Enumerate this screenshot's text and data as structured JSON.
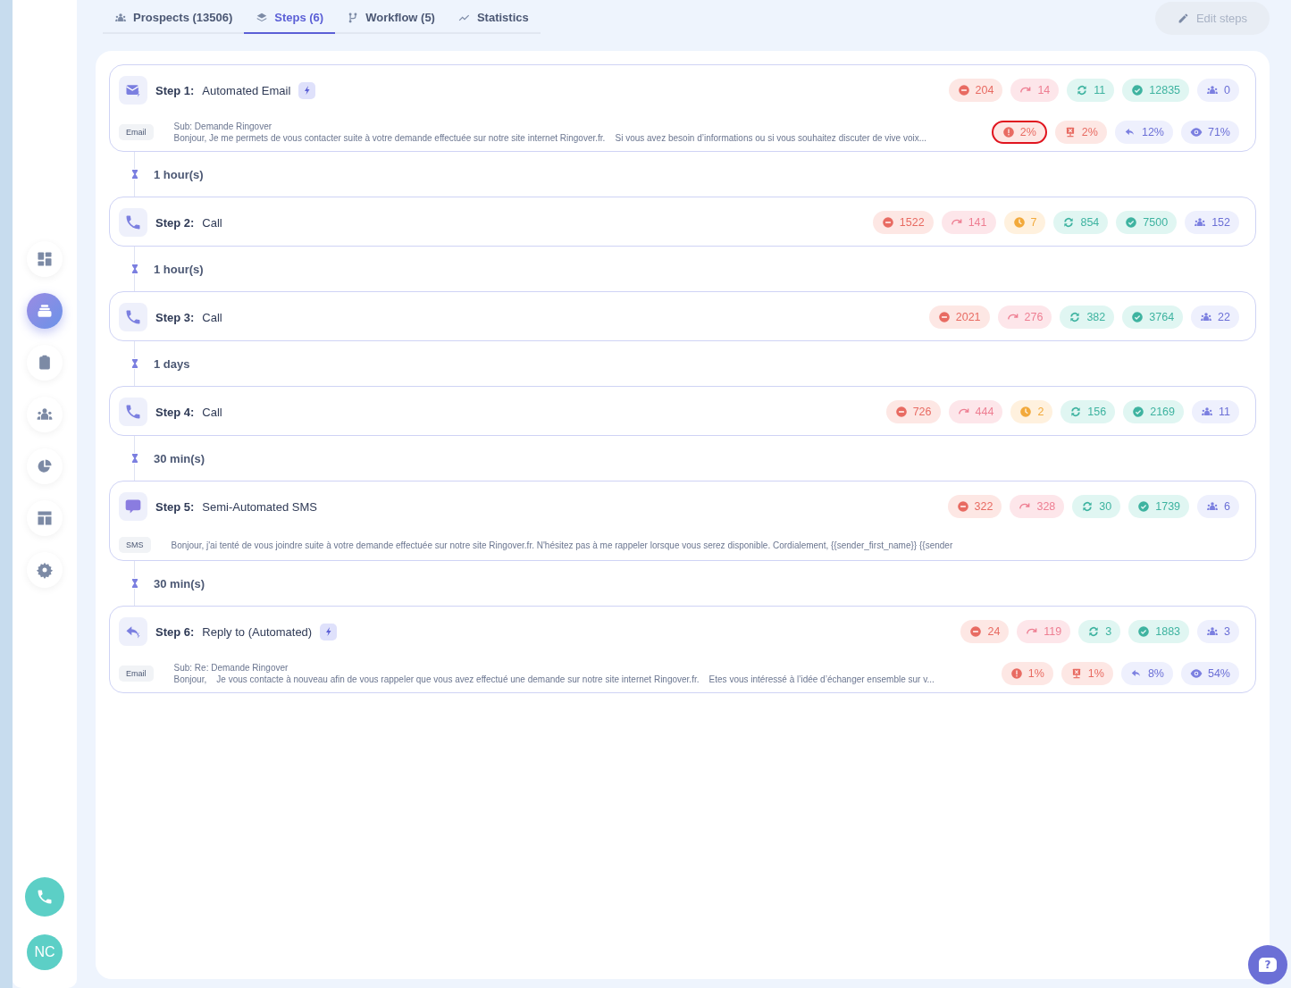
{
  "sidebar": {
    "items": [
      {
        "selected": false
      },
      {
        "selected": true
      },
      {
        "selected": false
      },
      {
        "selected": false
      },
      {
        "selected": false
      },
      {
        "selected": false
      },
      {
        "selected": false
      }
    ],
    "avatar": "NC"
  },
  "tabs": [
    {
      "label": "Prospects (13506)",
      "selected": false
    },
    {
      "label": "Steps (6)",
      "selected": true
    },
    {
      "label": "Workflow (5)",
      "selected": false
    },
    {
      "label": "Statistics",
      "selected": false
    }
  ],
  "help_button": {
    "label": "?"
  },
  "edit_button": {
    "label": "Edit steps",
    "disabled": true
  },
  "steps": [
    {
      "number": "Step 1:",
      "name": "Automated Email",
      "kind": "email",
      "automated": true,
      "stats": [
        {
          "kind": "bounced",
          "value": "204"
        },
        {
          "kind": "skipped",
          "value": "14"
        },
        {
          "kind": "recurring",
          "value": "11"
        },
        {
          "kind": "completed",
          "value": "12835"
        },
        {
          "kind": "prospects",
          "value": "0"
        }
      ],
      "message": {
        "tag": "Email",
        "subject": "Sub: Demande Ringover",
        "body": "Bonjour, Je me permets de vous contacter suite à votre demande effectuée sur notre site internet Ringover.fr.    Si vous avez besoin d’informations ou si vous souhaitez discuter de vive voix..."
      },
      "rates": [
        {
          "kind": "error",
          "value": "2%",
          "highlighted": true
        },
        {
          "kind": "unsubscribed",
          "value": "2%",
          "highlighted": false
        },
        {
          "kind": "replied",
          "value": "12%",
          "highlighted": false
        },
        {
          "kind": "opened",
          "value": "71%",
          "highlighted": false
        }
      ],
      "delay": "1 hour(s)"
    },
    {
      "number": "Step 2:",
      "name": "Call",
      "kind": "call",
      "automated": false,
      "stats": [
        {
          "kind": "bounced",
          "value": "1522"
        },
        {
          "kind": "skipped",
          "value": "141"
        },
        {
          "kind": "pending",
          "value": "7"
        },
        {
          "kind": "recurring",
          "value": "854"
        },
        {
          "kind": "completed",
          "value": "7500"
        },
        {
          "kind": "prospects",
          "value": "152"
        }
      ],
      "delay": "1 hour(s)"
    },
    {
      "number": "Step 3:",
      "name": "Call",
      "kind": "call",
      "automated": false,
      "stats": [
        {
          "kind": "bounced",
          "value": "2021"
        },
        {
          "kind": "skipped",
          "value": "276"
        },
        {
          "kind": "recurring",
          "value": "382"
        },
        {
          "kind": "completed",
          "value": "3764"
        },
        {
          "kind": "prospects",
          "value": "22"
        }
      ],
      "delay": "1 days"
    },
    {
      "number": "Step 4:",
      "name": "Call",
      "kind": "call",
      "automated": false,
      "stats": [
        {
          "kind": "bounced",
          "value": "726"
        },
        {
          "kind": "skipped",
          "value": "444"
        },
        {
          "kind": "pending",
          "value": "2"
        },
        {
          "kind": "recurring",
          "value": "156"
        },
        {
          "kind": "completed",
          "value": "2169"
        },
        {
          "kind": "prospects",
          "value": "11"
        }
      ],
      "delay": "30 min(s)"
    },
    {
      "number": "Step 5:",
      "name": "Semi-Automated SMS",
      "kind": "sms",
      "automated": false,
      "stats": [
        {
          "kind": "bounced",
          "value": "322"
        },
        {
          "kind": "skipped",
          "value": "328"
        },
        {
          "kind": "recurring",
          "value": "30"
        },
        {
          "kind": "completed",
          "value": "1739"
        },
        {
          "kind": "prospects",
          "value": "6"
        }
      ],
      "message": {
        "tag": "SMS",
        "body": "Bonjour, j'ai tenté de vous joindre suite à votre demande effectuée sur notre site Ringover.fr. N'hésitez pas à me rappeler lorsque vous serez disponible. Cordialement, {{sender_first_name}} {{sender"
      },
      "delay": "30 min(s)"
    },
    {
      "number": "Step 6:",
      "name": "Reply to (Automated)",
      "kind": "reply",
      "automated": true,
      "stats": [
        {
          "kind": "bounced",
          "value": "24"
        },
        {
          "kind": "skipped",
          "value": "119"
        },
        {
          "kind": "recurring",
          "value": "3"
        },
        {
          "kind": "completed",
          "value": "1883"
        },
        {
          "kind": "prospects",
          "value": "3"
        }
      ],
      "message": {
        "tag": "Email",
        "subject": "Sub: Re: Demande Ringover",
        "body": "Bonjour,    Je vous contacte à nouveau afin de vous rappeler que vous avez effectué une demande sur notre site internet Ringover.fr.    Etes vous intéressé à l’idée d’échanger ensemble sur v..."
      },
      "rates": [
        {
          "kind": "error",
          "value": "1%",
          "highlighted": false
        },
        {
          "kind": "unsubscribed",
          "value": "1%",
          "highlighted": false
        },
        {
          "kind": "replied",
          "value": "8%",
          "highlighted": false
        },
        {
          "kind": "opened",
          "value": "54%",
          "highlighted": false
        }
      ]
    }
  ]
}
